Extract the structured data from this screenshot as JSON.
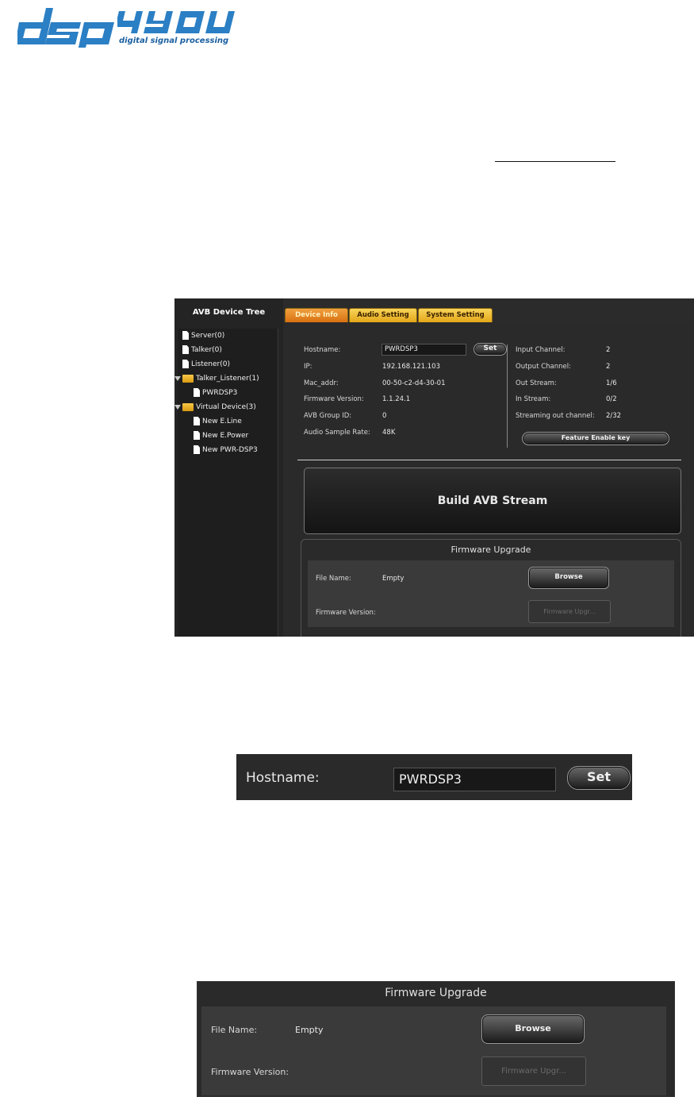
{
  "logo": {
    "brand": "dsp4you",
    "tagline": "digital signal processing"
  },
  "app": {
    "tree": {
      "title": "AVB Device Tree",
      "items": [
        {
          "label": "Server(0)",
          "icon": "document-icon"
        },
        {
          "label": "Talker(0)",
          "icon": "document-icon"
        },
        {
          "label": "Listener(0)",
          "icon": "document-icon"
        },
        {
          "label": "Talker_Listener(1)",
          "icon": "folder-icon"
        },
        {
          "label": "PWRDSP3",
          "icon": "document-icon"
        },
        {
          "label": "Virtual Device(3)",
          "icon": "folder-icon"
        },
        {
          "label": "New E.Line",
          "icon": "document-icon"
        },
        {
          "label": "New E.Power",
          "icon": "document-icon"
        },
        {
          "label": "New PWR-DSP3",
          "icon": "document-icon"
        }
      ]
    },
    "tabs": [
      {
        "label": "Device Info",
        "active": true
      },
      {
        "label": "Audio Setting",
        "active": false
      },
      {
        "label": "System Setting",
        "active": false
      }
    ],
    "info": {
      "hostname_label": "Hostname:",
      "hostname_value": "PWRDSP3",
      "set_label": "Set",
      "ip_label": "IP:",
      "ip_value": "192.168.121.103",
      "mac_label": "Mac_addr:",
      "mac_value": "00-50-c2-d4-30-01",
      "fw_label": "Firmware Version:",
      "fw_value": "1.1.24.1",
      "group_label": "AVB Group ID:",
      "group_value": "0",
      "rate_label": "Audio Sample Rate:",
      "rate_value": "48K",
      "in_ch_label": "Input Channel:",
      "in_ch_value": "2",
      "out_ch_label": "Output Channel:",
      "out_ch_value": "2",
      "out_stream_label": "Out Stream:",
      "out_stream_value": "1/6",
      "in_stream_label": "In Stream:",
      "in_stream_value": "0/2",
      "stream_out_label": "Streaming out channel:",
      "stream_out_value": "2/32",
      "feature_label": "Feature Enable key"
    },
    "build_label": "Build AVB Stream",
    "firmware": {
      "title": "Firmware Upgrade",
      "file_label": "File Name:",
      "file_value": "Empty",
      "browse_label": "Browse",
      "version_label": "Firmware Version:",
      "upgrade_label": "Firmware Upgr..."
    }
  },
  "host_zoom": {
    "label": "Hostname:",
    "value": "PWRDSP3",
    "set_label": "Set"
  },
  "fw_zoom": {
    "title": "Firmware Upgrade",
    "file_label": "File Name:",
    "file_value": "Empty",
    "browse_label": "Browse",
    "version_label": "Firmware Version:",
    "upgrade_label": "Firmware Upgr..."
  }
}
